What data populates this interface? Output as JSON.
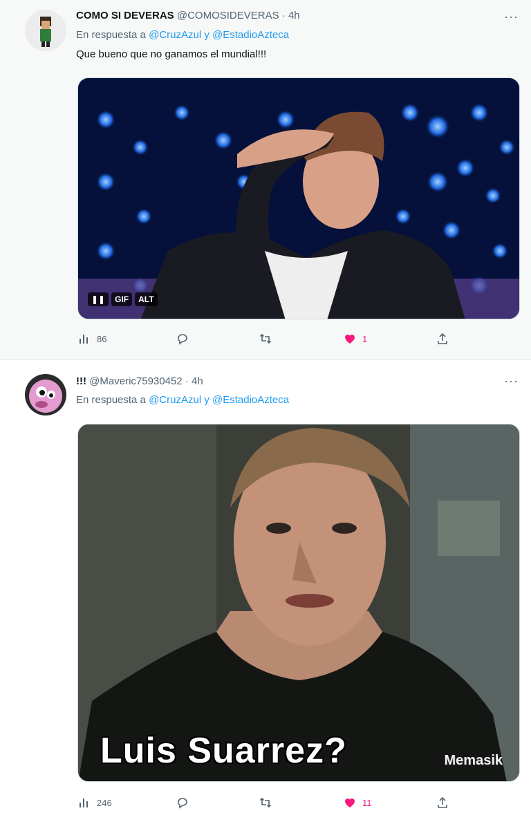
{
  "colors": {
    "accent": "#1d9bf0",
    "like": "#f91880",
    "muted": "#536471"
  },
  "tweets": [
    {
      "name": "COMO SI DEVERAS",
      "handle": "@COMOSIDEVERAS",
      "dot": "·",
      "time": "4h",
      "reply_prefix": "En respuesta a",
      "mention1": "@CruzAzul",
      "reply_join": "y",
      "mention2": "@EstadioAzteca",
      "text": "Que bueno que no ganamos el mundial!!!",
      "media_badges": [
        "GIF",
        "ALT"
      ],
      "views": "86",
      "likes": "1",
      "icons": [
        "views-icon",
        "reply-icon",
        "retweet-icon",
        "heart-icon",
        "share-icon"
      ]
    },
    {
      "name": "!!!",
      "handle": "@Maveric75930452",
      "dot": "·",
      "time": "4h",
      "reply_prefix": "En respuesta a",
      "mention1": "@CruzAzul",
      "reply_join": "y",
      "mention2": "@EstadioAzteca",
      "image_caption": "Luis Suarrez?",
      "watermark": "Memasik",
      "views": "246",
      "likes": "11",
      "icons": [
        "views-icon",
        "reply-icon",
        "retweet-icon",
        "heart-icon",
        "share-icon"
      ]
    }
  ]
}
